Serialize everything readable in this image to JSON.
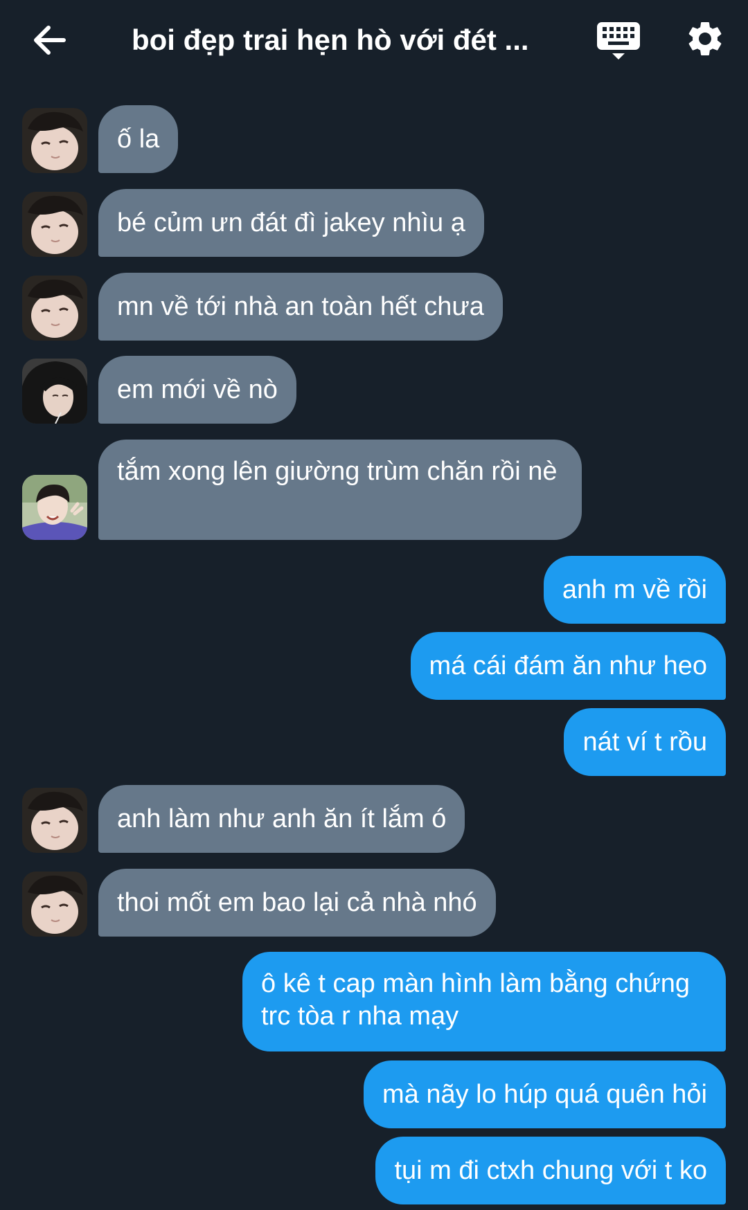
{
  "header": {
    "title": "boi đẹp trai hẹn hò với đét ...",
    "back_icon": "arrow-left-icon",
    "keyboard_icon": "keyboard-icon",
    "settings_icon": "gear-icon"
  },
  "colors": {
    "background": "#17202a",
    "incoming_bubble": "#66788a",
    "outgoing_bubble": "#1d9bf0"
  },
  "messages": [
    {
      "dir": "in",
      "text": "ố la"
    },
    {
      "dir": "in",
      "text": "bé củm ưn đát đì jakey nhìu ạ"
    },
    {
      "dir": "in",
      "text": "mn về tới nhà an toàn hết chưa"
    },
    {
      "dir": "in",
      "text": "em mới về nò"
    },
    {
      "dir": "in",
      "text": "tắm xong lên giường trùm chăn rồi nè"
    },
    {
      "dir": "out",
      "text": "anh m về rồi"
    },
    {
      "dir": "out",
      "text": "má cái đám ăn như heo"
    },
    {
      "dir": "out",
      "text": "nát ví t rồu"
    },
    {
      "dir": "in",
      "text": "anh làm như anh ăn ít lắm ó"
    },
    {
      "dir": "in",
      "text": "thoi mốt em bao lại cả nhà nhó"
    },
    {
      "dir": "out",
      "text": "ô kê t cap màn hình làm bằng chứng trc tòa r nha mạy"
    },
    {
      "dir": "out",
      "text": "mà nãy lo húp quá quên hỏi"
    },
    {
      "dir": "out",
      "text": "tụi m đi ctxh chung với t ko"
    }
  ]
}
